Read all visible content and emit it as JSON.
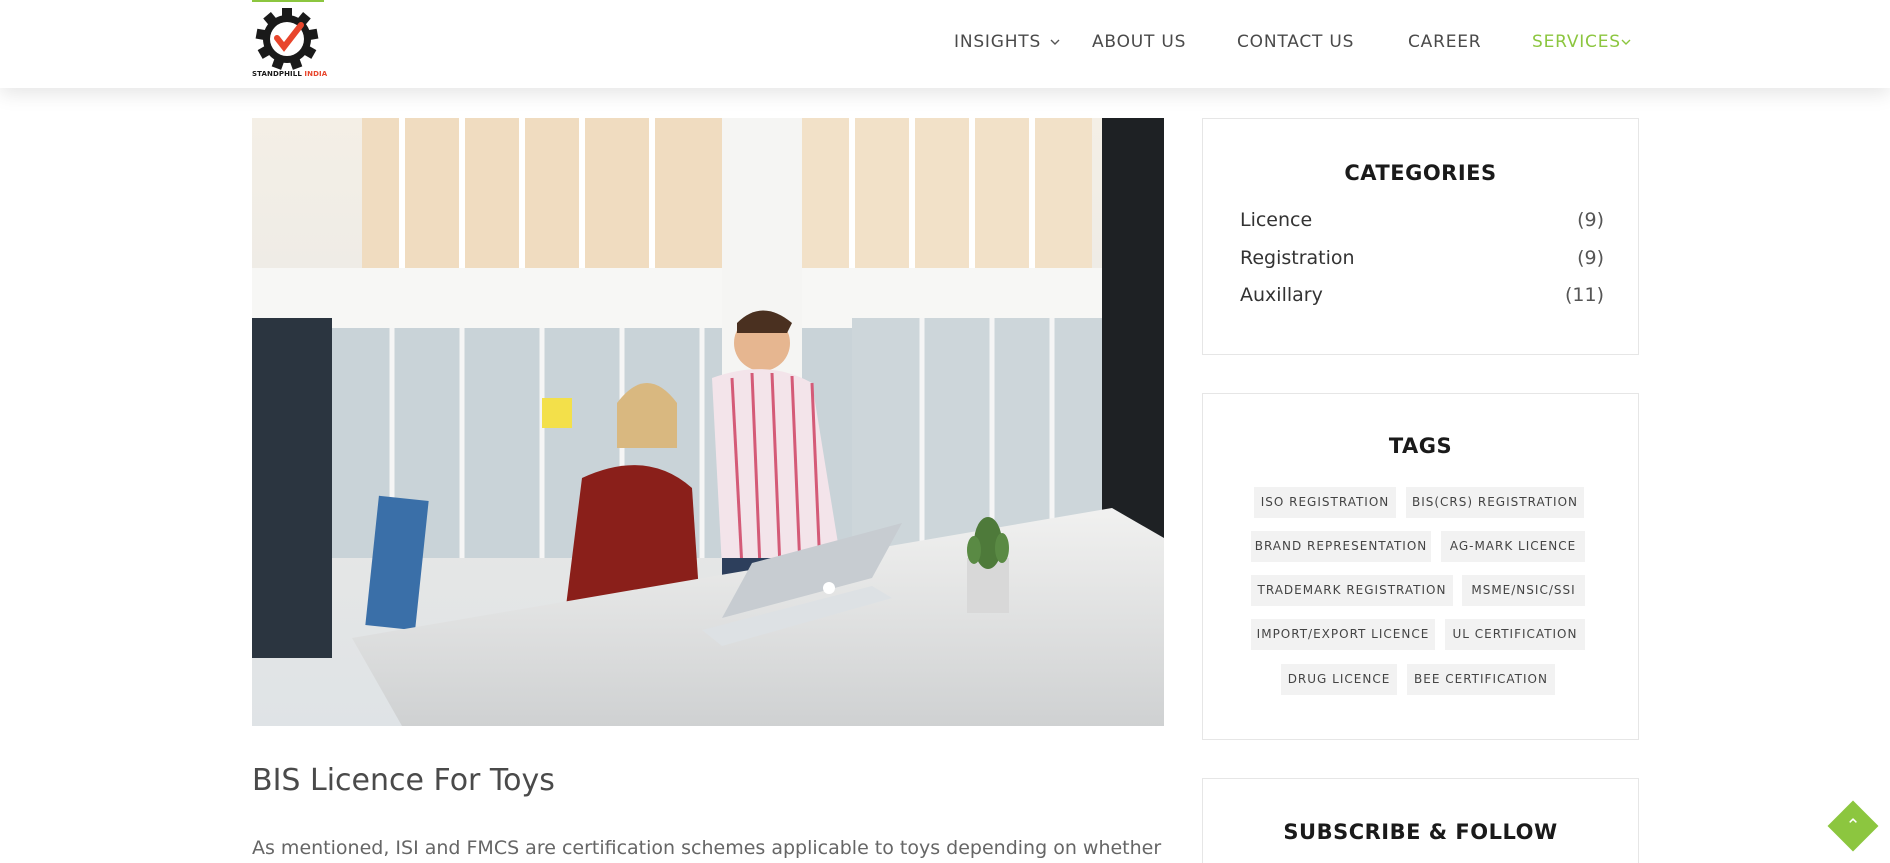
{
  "brand": {
    "name_part1": "STANDPHILL",
    "name_part2": "INDIA"
  },
  "nav": {
    "items": [
      {
        "label": "INSIGHTS",
        "has_dropdown": true,
        "active": false
      },
      {
        "label": "ABOUT US",
        "has_dropdown": false,
        "active": false
      },
      {
        "label": "CONTACT US",
        "has_dropdown": false,
        "active": false
      },
      {
        "label": "CAREER",
        "has_dropdown": false,
        "active": false
      },
      {
        "label": "SERVICES",
        "has_dropdown": true,
        "active": true
      }
    ]
  },
  "post": {
    "title": "BIS Licence For Toys",
    "excerpt": "As mentioned, ISI and FMCS are certification schemes applicable to toys depending on whether"
  },
  "sidebar": {
    "categories": {
      "title": "CATEGORIES",
      "items": [
        {
          "label": "Licence",
          "count": "(9)"
        },
        {
          "label": "Registration",
          "count": "(9)"
        },
        {
          "label": "Auxillary",
          "count": "(11)"
        }
      ]
    },
    "tags": {
      "title": "TAGS",
      "items": [
        "ISO REGISTRATION",
        "BIS(CRS) REGISTRATION",
        "BRAND REPRESENTATION",
        "AG-MARK LICENCE",
        "TRADEMARK REGISTRATION",
        "MSME/NSIC/SSI",
        "IMPORT/EXPORT LICENCE",
        "UL CERTIFICATION",
        "DRUG LICENCE",
        "BEE CERTIFICATION"
      ]
    },
    "subscribe": {
      "title": "SUBSCRIBE & FOLLOW"
    }
  },
  "colors": {
    "accent": "#8cc63f",
    "logo_red": "#e8452c",
    "logo_dark": "#1a1a1a"
  },
  "icons": {
    "scroll_top": "chevron-up-icon",
    "dropdown": "chevron-down-icon"
  }
}
